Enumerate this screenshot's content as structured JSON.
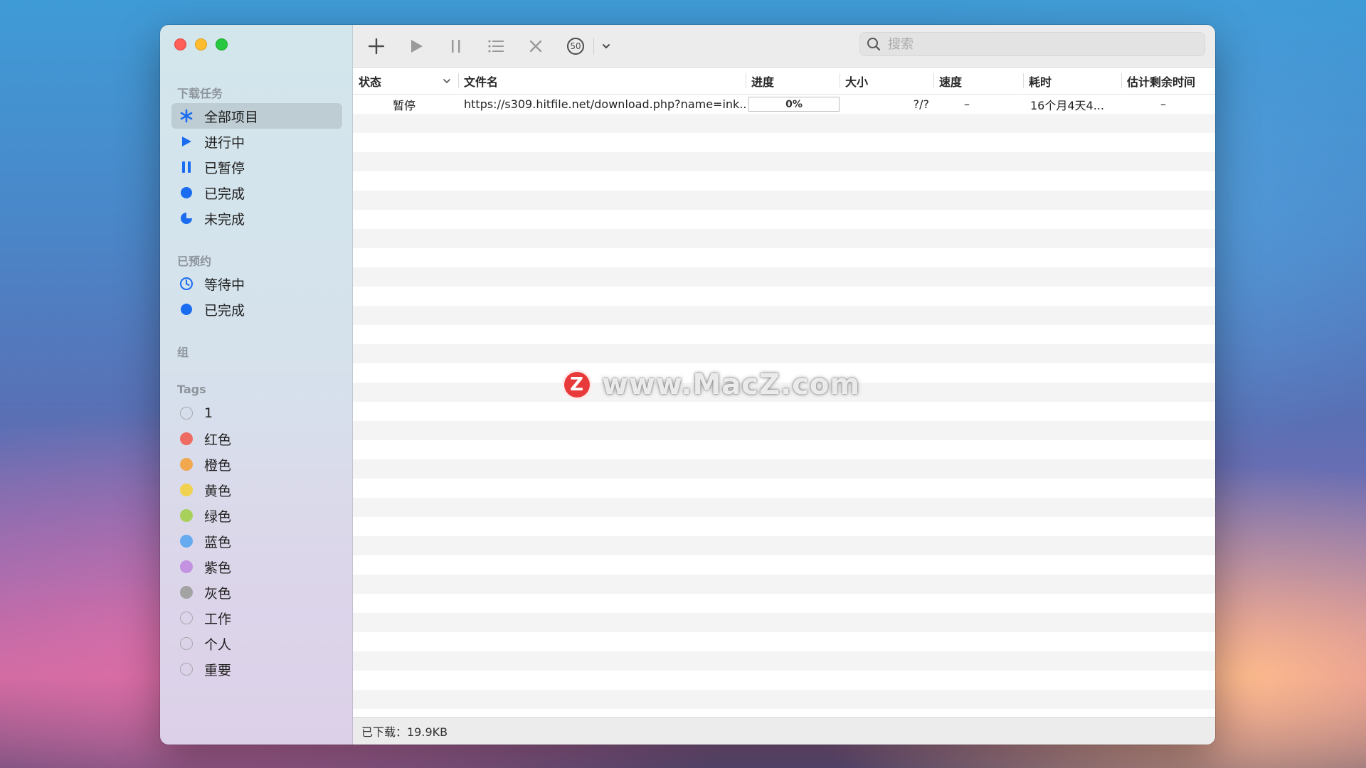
{
  "sidebar": {
    "section_downloads": "下载任务",
    "downloads": [
      {
        "label": "全部项目",
        "icon": "asterisk-icon",
        "active": true
      },
      {
        "label": "进行中",
        "icon": "play-icon"
      },
      {
        "label": "已暂停",
        "icon": "pause-icon"
      },
      {
        "label": "已完成",
        "icon": "filled-circle-icon"
      },
      {
        "label": "未完成",
        "icon": "half-moon-icon"
      }
    ],
    "section_scheduled": "已预约",
    "scheduled": [
      {
        "label": "等待中",
        "icon": "clock-icon"
      },
      {
        "label": "已完成",
        "icon": "filled-circle-icon"
      }
    ],
    "section_groups": "组",
    "section_tags": "Tags",
    "tags": [
      {
        "label": "1",
        "color": ""
      },
      {
        "label": "红色",
        "color": "#ee6b61"
      },
      {
        "label": "橙色",
        "color": "#f1a84f"
      },
      {
        "label": "黄色",
        "color": "#f1d250"
      },
      {
        "label": "绿色",
        "color": "#a7d15a"
      },
      {
        "label": "蓝色",
        "color": "#66aaf0"
      },
      {
        "label": "紫色",
        "color": "#c393e2"
      },
      {
        "label": "灰色",
        "color": "#a3a3a3"
      },
      {
        "label": "工作",
        "color": ""
      },
      {
        "label": "个人",
        "color": ""
      },
      {
        "label": "重要",
        "color": ""
      }
    ]
  },
  "toolbar": {
    "speed_limit": "50",
    "search_placeholder": "搜索"
  },
  "table": {
    "columns": [
      "状态",
      "文件名",
      "进度",
      "大小",
      "速度",
      "耗时",
      "估计剩余时间"
    ],
    "rows": [
      {
        "status": "暂停",
        "filename": "https://s309.hitfile.net/download.php?name=ink...",
        "progress": "0%",
        "size": "?/?",
        "speed": "–",
        "elapsed": "16个月4天4...",
        "remaining": "–"
      }
    ]
  },
  "statusbar": {
    "downloaded": "已下载：19.9KB"
  },
  "watermark": {
    "logo": "Z",
    "text": "www.MacZ.com"
  },
  "colors": {
    "accent": "#1a6cf0"
  }
}
